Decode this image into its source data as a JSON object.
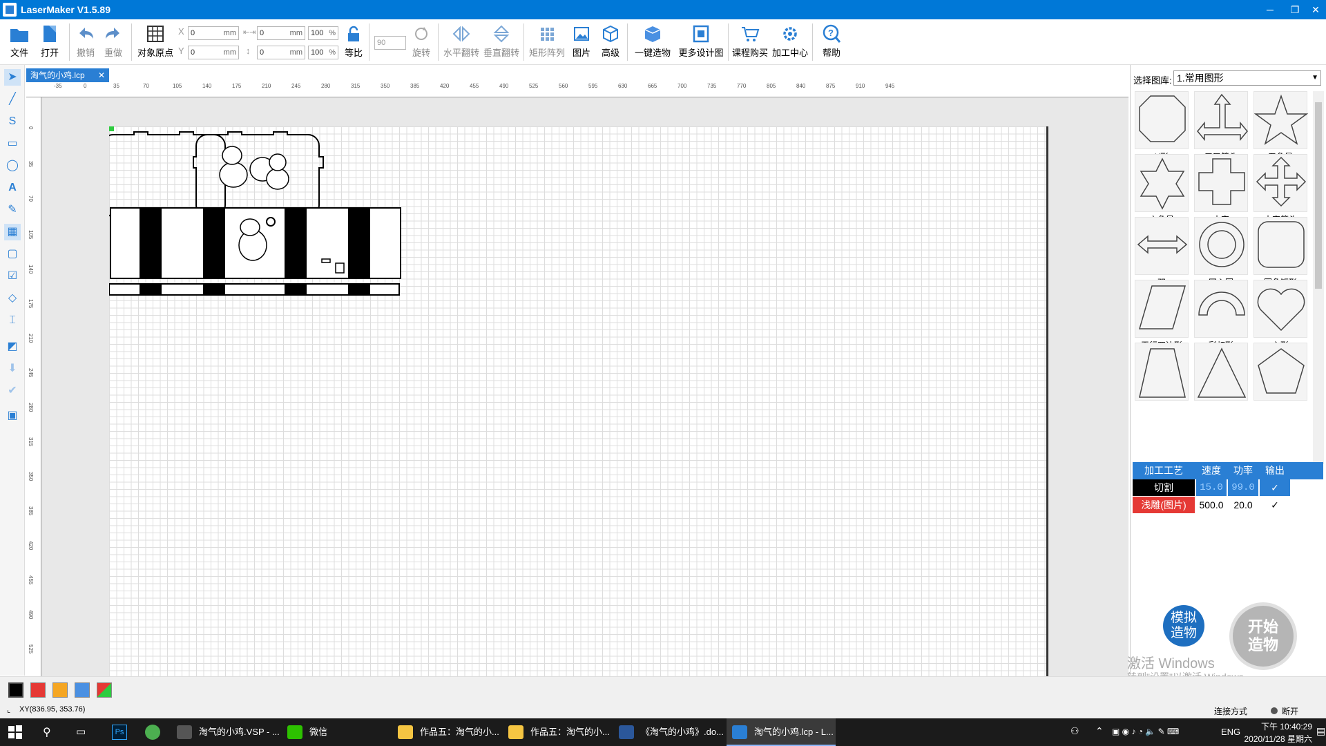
{
  "window": {
    "title": "LaserMaker V1.5.89"
  },
  "toolbar": {
    "file": "文件",
    "open": "打开",
    "undo": "撤销",
    "redo": "重做",
    "object_origin": "对象原点",
    "x_label": "X",
    "y_label": "Y",
    "x_value": "0",
    "y_value": "0",
    "w_value": "0",
    "h_value": "0",
    "unit": "mm",
    "w_pct": "100",
    "h_pct": "100",
    "pct": "%",
    "proportional": "等比",
    "angle_value": "90",
    "rotate": "旋转",
    "flip_h": "水平翻转",
    "flip_v": "垂直翻转",
    "rect_array": "矩形阵列",
    "image": "图片",
    "advanced": "高级",
    "one_click": "一键造物",
    "more_designs": "更多设计图",
    "course_buy": "课程购买",
    "processing_center": "加工中心",
    "help": "帮助"
  },
  "document": {
    "tab_name": "淘气的小鸡.lcp",
    "close": "✕"
  },
  "ruler": {
    "top_ticks": [
      "-35",
      "0",
      "35",
      "70",
      "105",
      "140",
      "175",
      "210",
      "245",
      "280",
      "315",
      "350",
      "385",
      "420",
      "455",
      "490",
      "525",
      "560",
      "595",
      "630",
      "665",
      "700",
      "735",
      "770",
      "805",
      "840",
      "875",
      "910",
      "945"
    ],
    "left_ticks": [
      "0",
      "35",
      "70",
      "105",
      "140",
      "175",
      "210",
      "245",
      "280",
      "315",
      "350",
      "385",
      "420",
      "455",
      "490",
      "525"
    ]
  },
  "library": {
    "label": "选择图库:",
    "selected": "1.常用图形",
    "shapes": [
      {
        "name": "X形",
        "icon": "octagon-icon"
      },
      {
        "name": "三叉箭头",
        "icon": "three-way-arrow-icon"
      },
      {
        "name": "五角星",
        "icon": "five-star-icon"
      },
      {
        "name": "六角星",
        "icon": "six-star-icon"
      },
      {
        "name": "十字",
        "icon": "cross-icon"
      },
      {
        "name": "十字箭头",
        "icon": "cross-arrow-icon"
      },
      {
        "name": "双",
        "icon": "double-arrow-icon"
      },
      {
        "name": "同心圆",
        "icon": "concentric-circle-icon"
      },
      {
        "name": "圆角矩形",
        "icon": "rounded-rect-icon"
      },
      {
        "name": "平行四边形",
        "icon": "parallelogram-icon"
      },
      {
        "name": "彩虹形",
        "icon": "rainbow-icon"
      },
      {
        "name": "心形",
        "icon": "heart-icon"
      },
      {
        "name": "",
        "icon": "trapezoid-icon"
      },
      {
        "name": "",
        "icon": "triangle-icon"
      },
      {
        "name": "",
        "icon": "pentagon-icon"
      }
    ]
  },
  "process_table": {
    "headers": [
      "加工工艺",
      "速度",
      "功率",
      "输出"
    ],
    "rows": [
      {
        "process": "切割",
        "speed": "15.0",
        "power": "99.0",
        "output": "✓",
        "color": "#000000"
      },
      {
        "process": "浅雕(图片)",
        "speed": "500.0",
        "power": "20.0",
        "output": "✓",
        "color": "#e53935"
      }
    ]
  },
  "actions": {
    "simulate": "模拟造物",
    "start": "开始造物"
  },
  "watermark": {
    "line1": "激活 Windows",
    "line2": "转到\"设置\"以激活 Windows。"
  },
  "colors": [
    "#000000",
    "#e53935",
    "#f5a623",
    "#4a90e2",
    "multi"
  ],
  "status": {
    "coords": "XY(836.95, 353.76)",
    "connection_label": "连接方式",
    "connection_state": "断开"
  },
  "taskbar": {
    "items": [
      {
        "label": "淘气的小鸡.VSP - ...",
        "icon": "camera-app-icon"
      },
      {
        "label": "微信",
        "icon": "wechat-icon"
      },
      {
        "label": "作品五：淘气的小...",
        "icon": "folder-icon"
      },
      {
        "label": "作品五：淘气的小...",
        "icon": "folder-icon"
      },
      {
        "label": "《淘气的小鸡》.do...",
        "icon": "word-icon"
      },
      {
        "label": "淘气的小鸡.lcp - L...",
        "icon": "lasermaker-icon"
      }
    ],
    "lang": "ENG",
    "time": "下午 10:40:29",
    "date": "2020/11/28 星期六"
  }
}
